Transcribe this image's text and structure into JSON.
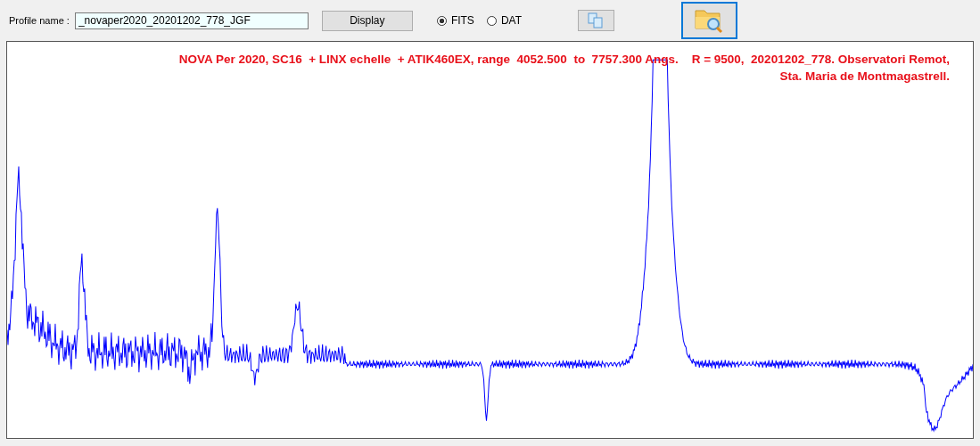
{
  "toolbar": {
    "profile_label": "Profile name :",
    "profile_value": "_novaper2020_20201202_778_JGF",
    "display_button": "Display",
    "formats": [
      {
        "label": "FITS",
        "selected": true
      },
      {
        "label": "DAT",
        "selected": false
      }
    ]
  },
  "plot": {
    "title_lines": [
      "NOVA Per 2020, SC16  + LINX echelle  + ATIK460EX, range  4052.500  to  7757.300 Angs.    R = 9500,  20201202_778. Observatori Remot,",
      "Sta. Maria de Montmagastrell."
    ]
  }
}
